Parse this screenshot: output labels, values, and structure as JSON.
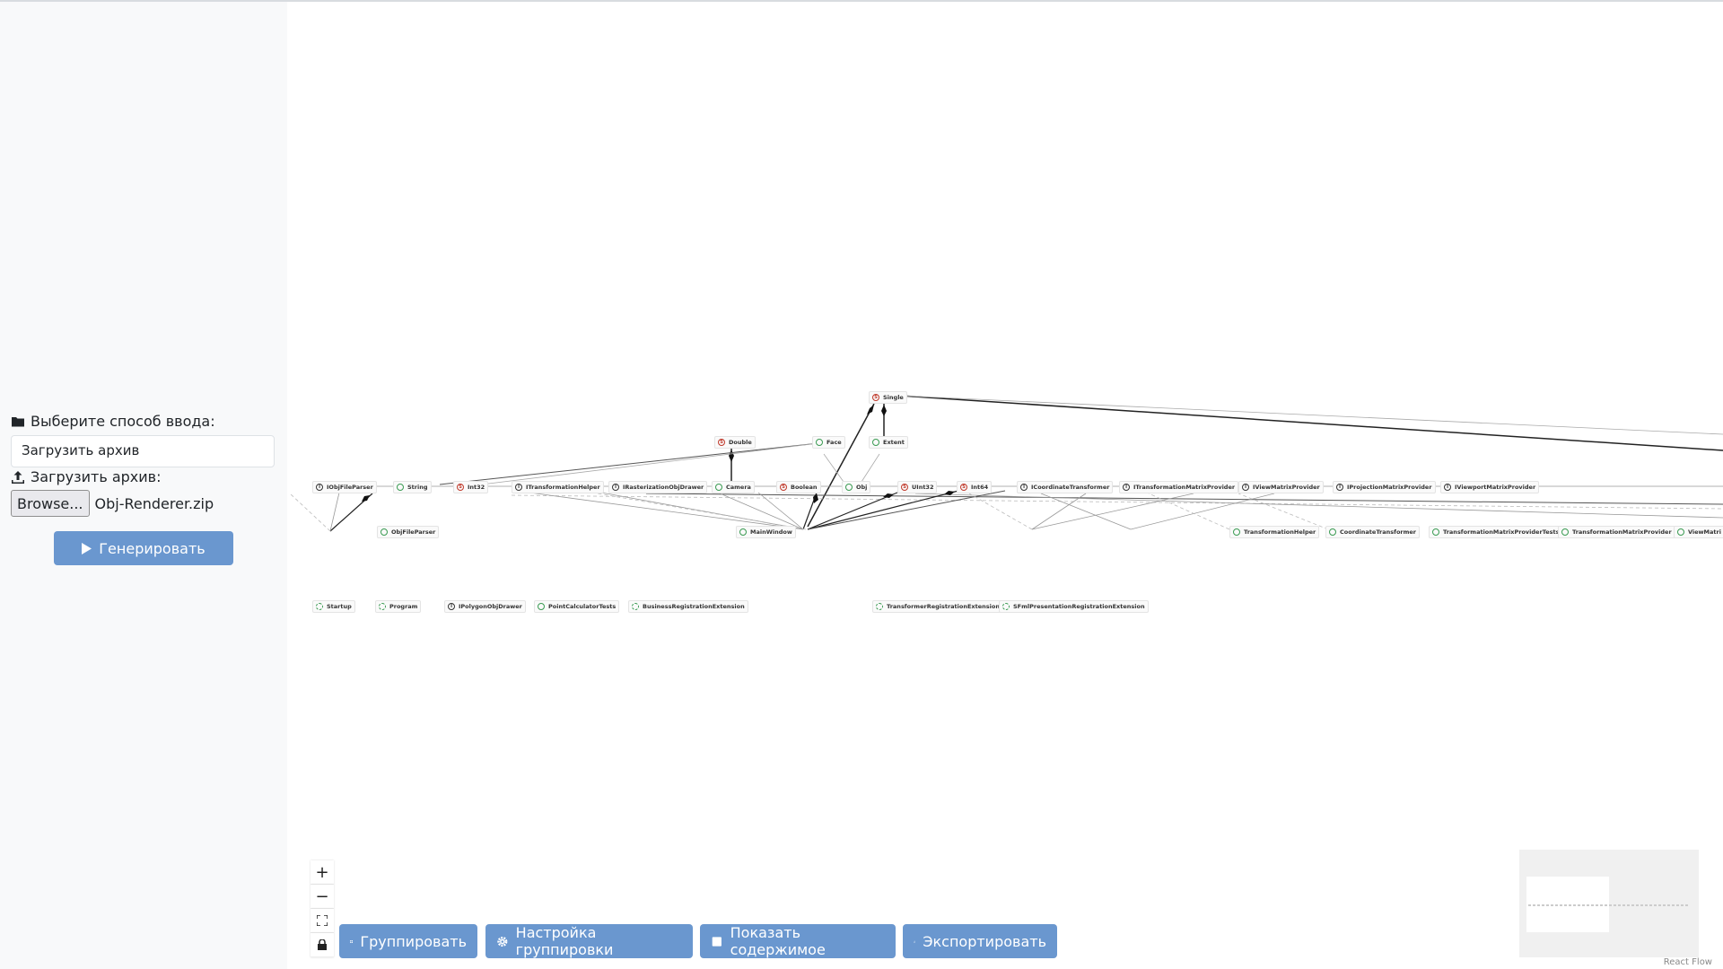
{
  "sidebar": {
    "input_mode_label": "Выберите способ ввода:",
    "input_mode_value": "Загрузить архив",
    "upload_label": "Загрузить архив:",
    "browse_label": "Browse...",
    "file_name": "Obj-Renderer.zip",
    "generate_label": "Генерировать"
  },
  "graph": {
    "nodes": [
      {
        "label": "Single",
        "kind": "struct"
      },
      {
        "label": "Double",
        "kind": "struct"
      },
      {
        "label": "Face",
        "kind": "class"
      },
      {
        "label": "Extent",
        "kind": "class"
      },
      {
        "label": "IObjFileParser",
        "kind": "interface"
      },
      {
        "label": "String",
        "kind": "class"
      },
      {
        "label": "Int32",
        "kind": "struct"
      },
      {
        "label": "ITransformationHelper",
        "kind": "interface"
      },
      {
        "label": "IRasterizationObjDrawer",
        "kind": "interface"
      },
      {
        "label": "Camera",
        "kind": "class"
      },
      {
        "label": "Boolean",
        "kind": "struct"
      },
      {
        "label": "Obj",
        "kind": "class"
      },
      {
        "label": "UInt32",
        "kind": "struct"
      },
      {
        "label": "Int64",
        "kind": "struct"
      },
      {
        "label": "ICoordinateTransformer",
        "kind": "interface"
      },
      {
        "label": "ITransformationMatrixProvider",
        "kind": "interface"
      },
      {
        "label": "IViewMatrixProvider",
        "kind": "interface"
      },
      {
        "label": "IProjectionMatrixProvider",
        "kind": "interface"
      },
      {
        "label": "IViewportMatrixProvider",
        "kind": "interface"
      },
      {
        "label": "ObjFileParser",
        "kind": "class"
      },
      {
        "label": "MainWindow",
        "kind": "class"
      },
      {
        "label": "TransformationHelper",
        "kind": "class"
      },
      {
        "label": "CoordinateTransformer",
        "kind": "class"
      },
      {
        "label": "TransformationMatrixProviderTests",
        "kind": "class"
      },
      {
        "label": "TransformationMatrixProvider",
        "kind": "class"
      },
      {
        "label": "ViewMatri",
        "kind": "class"
      },
      {
        "label": "Startup",
        "kind": "static"
      },
      {
        "label": "Program",
        "kind": "static"
      },
      {
        "label": "IPolygonObjDrawer",
        "kind": "interface"
      },
      {
        "label": "PointCalculatorTests",
        "kind": "class"
      },
      {
        "label": "BusinessRegistrationExtension",
        "kind": "static"
      },
      {
        "label": "TransformerRegistrationExtension",
        "kind": "static"
      },
      {
        "label": "SFmlPresentationRegistrationExtension",
        "kind": "static"
      }
    ]
  },
  "controls": {
    "zoom_in": "+",
    "zoom_out": "−",
    "fit_view": "⛶",
    "lock": "🔒"
  },
  "toolbar": {
    "group_label": "Группировать",
    "group_settings_label": "Настройка группировки",
    "show_content_label": "Показать содержимое",
    "export_label": "Экспортировать"
  },
  "attribution": "React Flow",
  "colors": {
    "accent": "#6a97cf",
    "sidebar_bg": "#f8f9fa",
    "class_icon": "#3a9b52",
    "struct_icon": "#c0392b"
  }
}
